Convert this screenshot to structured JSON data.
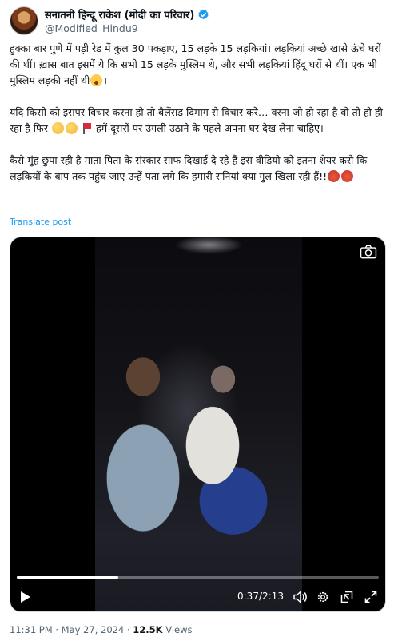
{
  "author": {
    "display_name": "सनातनी हिन्दू राकेश (मोदी का परिवार)",
    "handle": "@Modified_Hindu9"
  },
  "tweet": {
    "paragraph1": "हुक्का बार पुणे में पड़ी रेड में कुल 30  पकड़ाए, 15 लड़के 15 लड़कियां। लड़कियां अच्छे खासे ऊंचे घरों की थीं। ख़ास बात इसमें ये कि सभी 15 लड़के मुस्लिम थे, और सभी लड़कियां हिंदू घरों से थीं। एक भी मुस्लिम लड़की नहीं थी",
    "paragraph1_end": "।",
    "paragraph2_a": "यदि किसी को इसपर विचार करना हो तो बैलेंसड दिमाग से विचार करे… वरना जो हो रहा है वो तो हो ही रहा है फिर",
    "paragraph2_b": "हमें दूसरों पर उंगली उठाने के पहले अपना घर देख लेना चाहिए।",
    "paragraph3": "कैसे मुंह छुपा रही है माता पिता के संस्कार साफ दिखाई दे रहे हैं इस वीडियो को इतना शेयर करो कि लड़कियों के बाप तक पहुंच जाए उन्हें पता लगे कि हमारी रानियां क्या गुल खिला रही हैं!!"
  },
  "translate_label": "Translate post",
  "video": {
    "current_time": "0:37",
    "separator": "/",
    "duration": "2:13",
    "progress": 0.28
  },
  "meta": {
    "time": "11:31 PM",
    "dot1": "·",
    "date": "May 27, 2024",
    "dot2": "·",
    "views_count": "12.5K",
    "views_label": "Views"
  },
  "colors": {
    "link": "#1d9bf0",
    "verified": "#1d9bf0",
    "secondary_text": "#536471"
  },
  "icons": [
    "verified-badge-icon",
    "camera-icon",
    "play-icon",
    "volume-icon",
    "settings-icon",
    "pip-icon",
    "fullscreen-icon"
  ]
}
